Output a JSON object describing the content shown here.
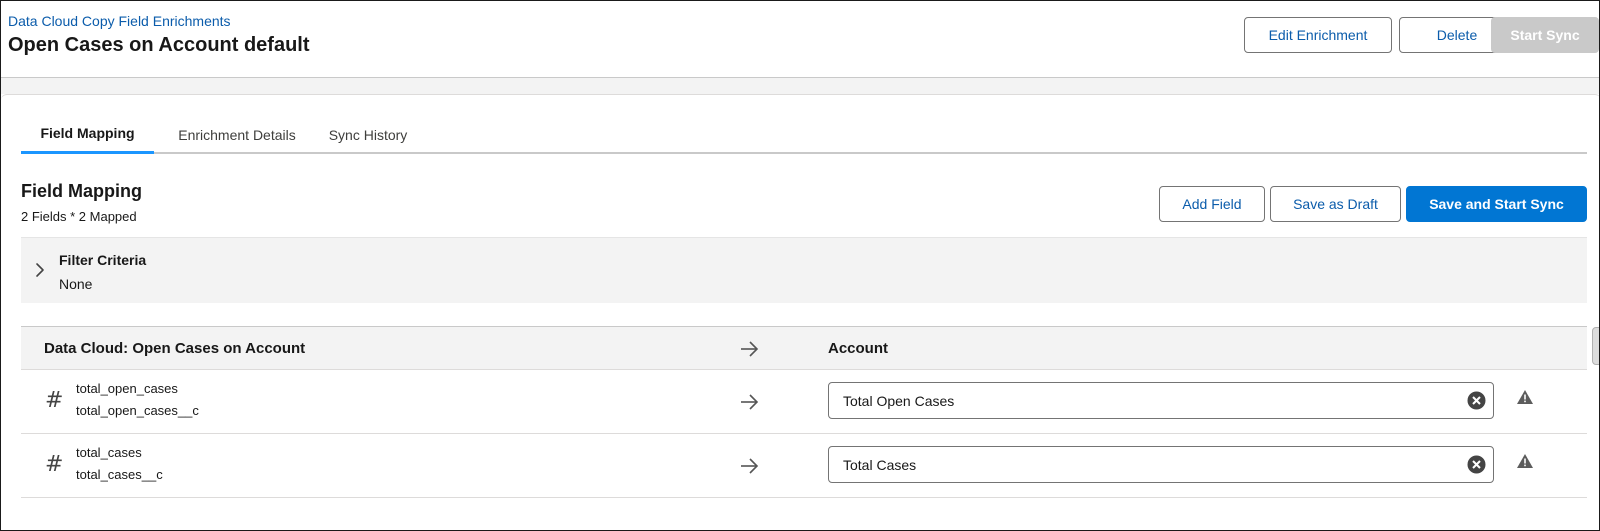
{
  "header": {
    "breadcrumb": "Data Cloud Copy Field Enrichments",
    "title": "Open Cases on Account default",
    "buttons": {
      "edit": "Edit Enrichment",
      "delete": "Delete",
      "start_sync": "Start Sync"
    }
  },
  "tabs": [
    {
      "label": "Field Mapping",
      "active": true
    },
    {
      "label": "Enrichment Details",
      "active": false
    },
    {
      "label": "Sync History",
      "active": false
    }
  ],
  "section": {
    "title": "Field Mapping",
    "subtitle": "2 Fields * 2 Mapped",
    "buttons": {
      "add_field": "Add Field",
      "save_draft": "Save as Draft",
      "save_start": "Save and Start Sync"
    }
  },
  "filter": {
    "title": "Filter Criteria",
    "value": "None"
  },
  "table": {
    "source_header": "Data Cloud: Open Cases on Account",
    "target_header": "Account",
    "rows": [
      {
        "field_name": "total_open_cases",
        "api_name": "total_open_cases__c",
        "target": "Total Open Cases",
        "icon": "number-icon"
      },
      {
        "field_name": "total_cases",
        "api_name": "total_cases__c",
        "target": "Total Cases",
        "icon": "number-icon"
      }
    ]
  },
  "colors": {
    "link": "#0b5cab",
    "brand": "#0176d3",
    "tab_active": "#1b96ff",
    "disabled": "#c9c9c9"
  }
}
